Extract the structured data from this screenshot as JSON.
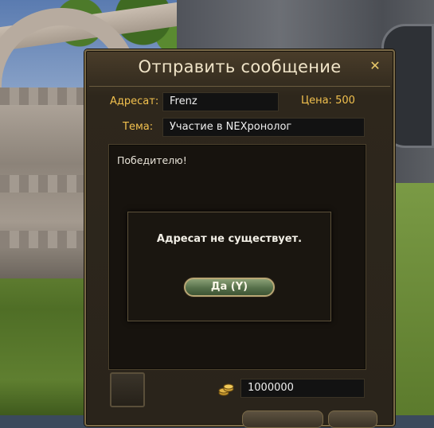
{
  "window": {
    "title": "Отправить сообщение",
    "recipient_label": "Адресат:",
    "recipient_value": "Frenz",
    "price_label": "Цена: 500",
    "subject_label": "Тема:",
    "subject_value": "Участие в NEXронолог",
    "message_body": "Победителю!",
    "money_value": "1000000"
  },
  "dialog": {
    "message": "Адресат не существует.",
    "ok_label": "Да (Y)"
  },
  "colors": {
    "label_gold": "#f2c14e",
    "title_text": "#f0e4c8",
    "button_green": "#56704a"
  },
  "icons": {
    "close": "close-icon",
    "money": "coin-stack-icon"
  }
}
